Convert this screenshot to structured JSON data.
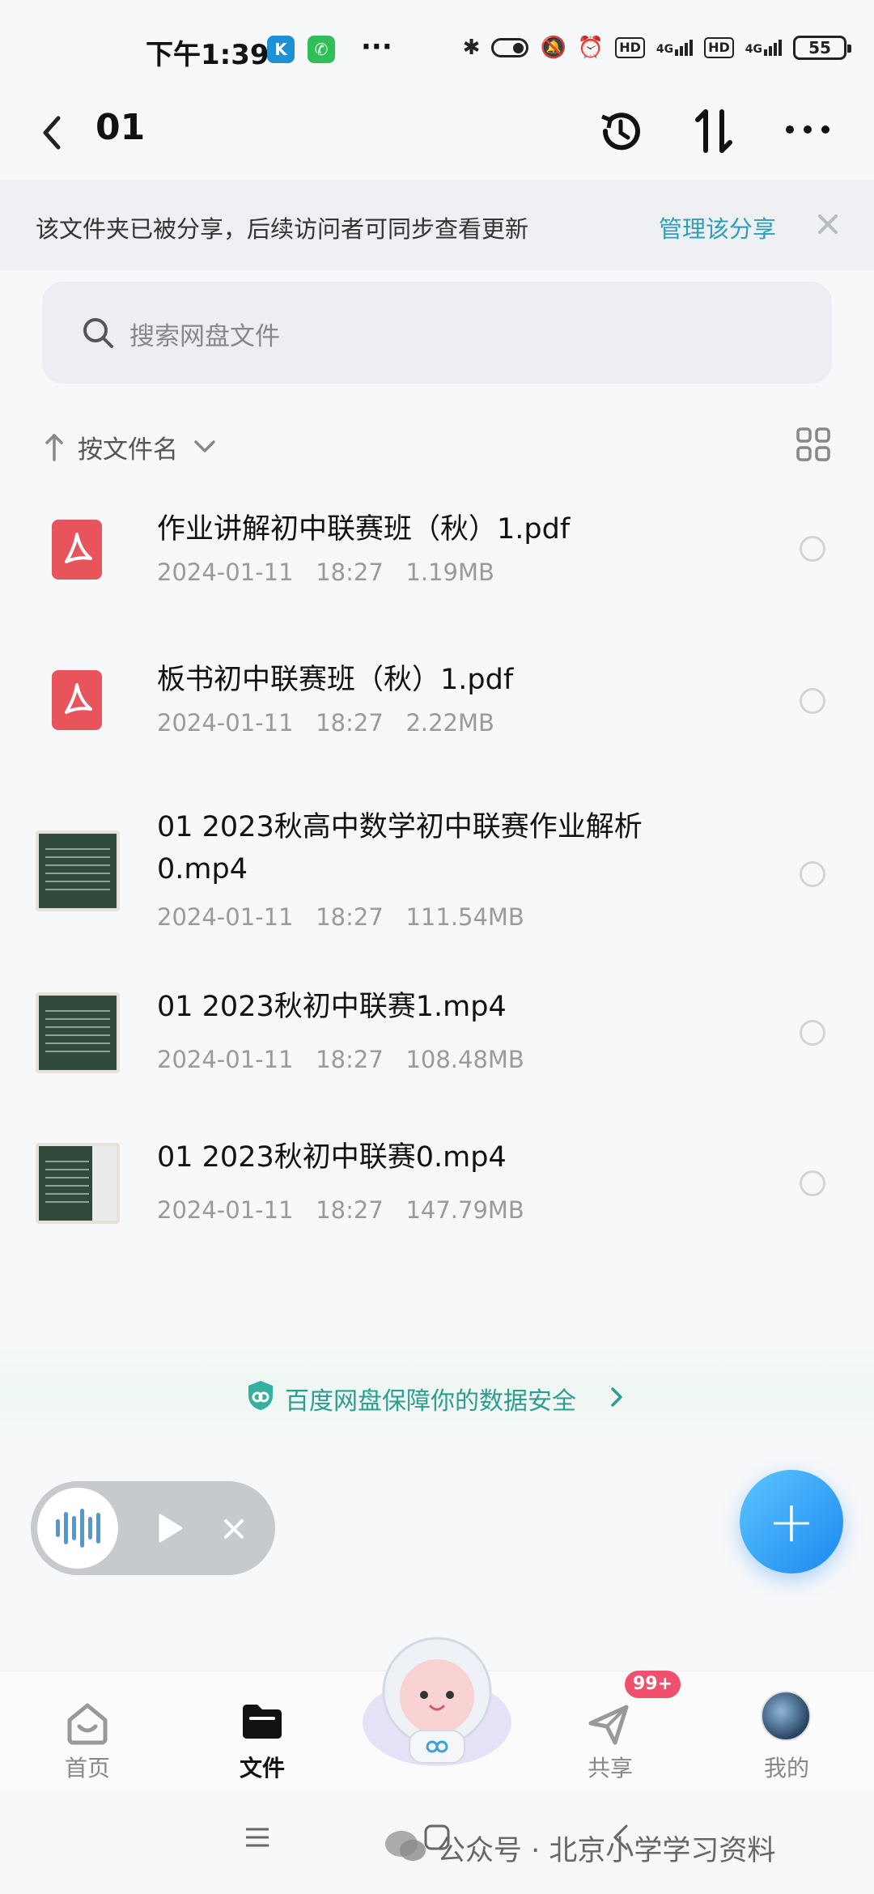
{
  "status_bar": {
    "time": "下午1:39",
    "app_badges": [
      {
        "text": "K",
        "color": "#1e90d6"
      },
      {
        "text": "✆",
        "color": "#2fbe57"
      }
    ],
    "dots": "···",
    "signal_label_1": "4G",
    "signal_label_2": "4G",
    "hd_label": "HD",
    "battery": "55"
  },
  "header": {
    "title": "01",
    "icons": [
      "back-icon",
      "history-icon",
      "sort-icon",
      "more-icon"
    ]
  },
  "share_bar": {
    "message": "该文件夹已被分享，后续访问者可同步查看更新",
    "manage_link": "管理该分享"
  },
  "search": {
    "placeholder": "搜索网盘文件"
  },
  "sort": {
    "label": "按文件名"
  },
  "files": [
    {
      "name": "作业讲解初中联赛班（秋）1.pdf",
      "date": "2024-01-11",
      "time": "18:27",
      "size": "1.19MB",
      "type": "pdf"
    },
    {
      "name": "板书初中联赛班（秋）1.pdf",
      "date": "2024-01-11",
      "time": "18:27",
      "size": "2.22MB",
      "type": "pdf"
    },
    {
      "name": "01 2023秋高中数学初中联赛作业解析0.mp4",
      "date": "2024-01-11",
      "time": "18:27",
      "size": "111.54MB",
      "type": "video"
    },
    {
      "name": "01 2023秋初中联赛1.mp4",
      "date": "2024-01-11",
      "time": "18:27",
      "size": "108.48MB",
      "type": "video"
    },
    {
      "name": "01 2023秋初中联赛0.mp4",
      "date": "2024-01-11",
      "time": "18:27",
      "size": "147.79MB",
      "type": "video"
    }
  ],
  "safety_text": "百度网盘保障你的数据安全",
  "fab_label": "+",
  "bottom_nav": {
    "items": [
      {
        "label": "首页",
        "active": false
      },
      {
        "label": "文件",
        "active": true
      },
      {
        "label": "共享",
        "active": false
      },
      {
        "label": "我的",
        "active": false
      }
    ],
    "badge": "99+"
  },
  "watermark": "公众号 · 北京小学学习资料",
  "colors": {
    "accent": "#2e9fb8",
    "pdf": "#e8545c",
    "fab": "#1b88f0",
    "badge": "#f0506e"
  }
}
